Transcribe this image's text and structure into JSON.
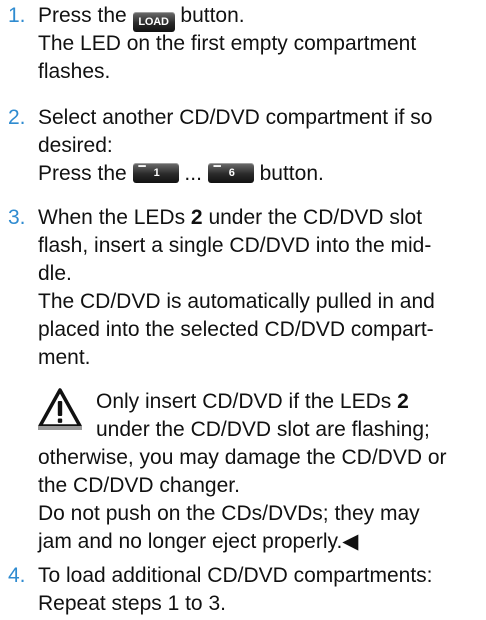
{
  "steps": [
    {
      "number": "1.",
      "lines": {
        "l1_pre": "Press the",
        "l1_button": "LOAD",
        "l1_post": "button.",
        "l2": "The LED on the first empty compartment",
        "l3": "flashes."
      }
    },
    {
      "number": "2.",
      "lines": {
        "l1": "Select another CD/DVD compartment if so",
        "l2": "desired:",
        "l3_pre": "Press the",
        "l3_button_a": "1",
        "l3_ellipsis": "...",
        "l3_button_b": "6",
        "l3_post": "button."
      }
    },
    {
      "number": "3.",
      "lines": {
        "l1_pre": "When the LEDs",
        "l1_bold": "2",
        "l1_post": "under the CD/DVD slot",
        "l2": "flash, insert a single CD/DVD into the mid-",
        "l3": "dle.",
        "l4": "The CD/DVD is automatically pulled in and",
        "l5": "placed into the selected CD/DVD compart-",
        "l6": "ment."
      }
    },
    {
      "number": "4.",
      "lines": {
        "l1": "To load additional CD/DVD compartments:",
        "l2": "Repeat steps 1 to 3."
      }
    }
  ],
  "warning": {
    "icon": "warning-triangle-icon",
    "l1_pre": "Only insert CD/DVD if the LEDs",
    "l1_bold": "2",
    "l2": "under the CD/DVD slot are flashing;",
    "l3": "otherwise, you may damage the CD/DVD or",
    "l4": "the CD/DVD changer.",
    "l5": "Do not push on the CDs/DVDs; they may",
    "l6": "jam and no longer eject properly.",
    "end_mark": "◀"
  },
  "colors": {
    "step_number": "#2f8bd0",
    "text": "#111111"
  }
}
